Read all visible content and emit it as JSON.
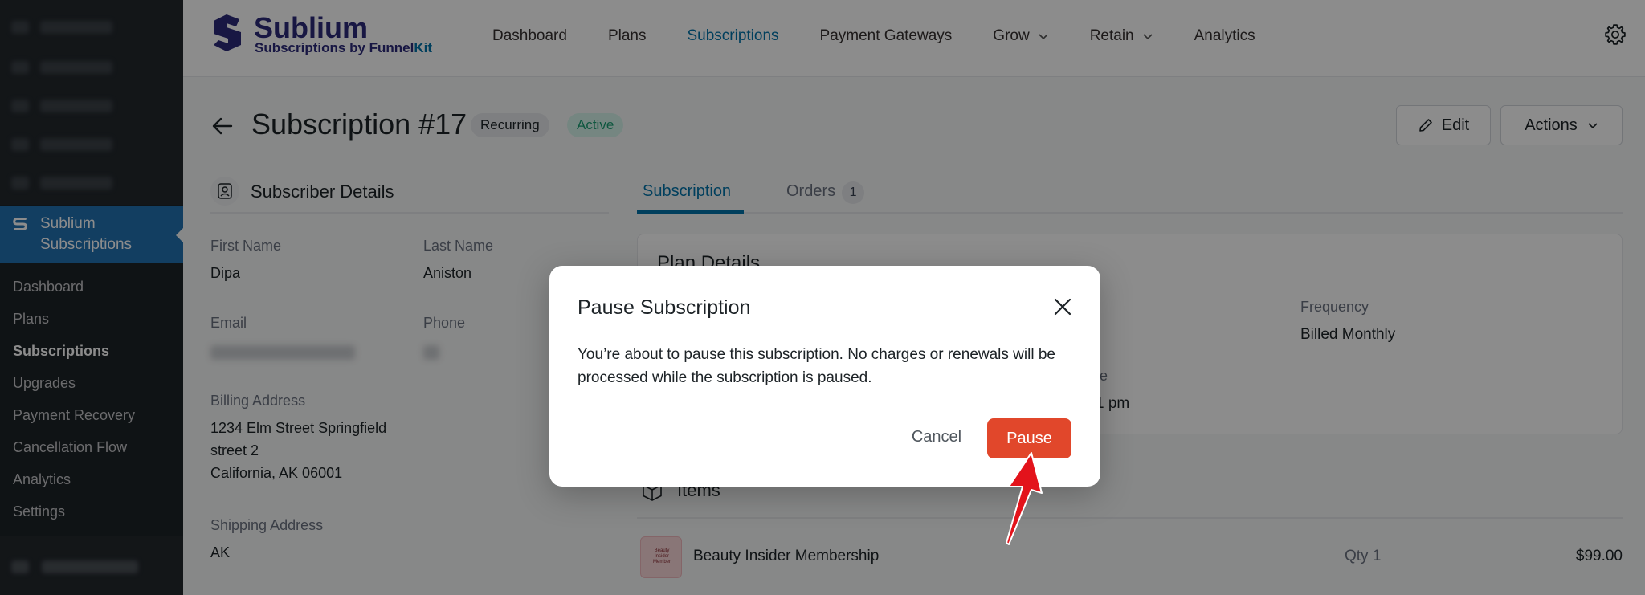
{
  "wp_sidebar": {
    "current_plugin": "Sublium Subscriptions",
    "submenu": [
      "Dashboard",
      "Plans",
      "Subscriptions",
      "Upgrades",
      "Payment Recovery",
      "Cancellation Flow",
      "Analytics",
      "Settings"
    ],
    "active_submenu": "Subscriptions"
  },
  "header": {
    "brand_name": "Sublium",
    "brand_sub_prefix": "Subscriptions by Funnel",
    "brand_sub_suffix": "Kit",
    "nav": [
      "Dashboard",
      "Plans",
      "Subscriptions",
      "Payment Gateways",
      "Grow",
      "Retain",
      "Analytics"
    ],
    "active_nav": "Subscriptions",
    "settings_icon": "gear-icon"
  },
  "page": {
    "title": "Subscription #17",
    "badge_type": "Recurring",
    "badge_status": "Active",
    "edit_label": "Edit",
    "actions_label": "Actions"
  },
  "subscriber": {
    "section_title": "Subscriber Details",
    "first_name_label": "First Name",
    "first_name": "Dipa",
    "last_name_label": "Last Name",
    "last_name": "Aniston",
    "email_label": "Email",
    "phone_label": "Phone",
    "billing_label": "Billing Address",
    "billing_line1": "1234 Elm Street Springfield",
    "billing_line2": "street 2",
    "billing_line3": "California, AK 06001",
    "shipping_label": "Shipping Address",
    "shipping_value": "AK"
  },
  "tabs": {
    "subscription": "Subscription",
    "orders": "Orders",
    "orders_count": "1"
  },
  "plan": {
    "title": "Plan Details",
    "frequency_label": "Frequency",
    "frequency_value": "Billed Monthly",
    "date_label_partial": "te",
    "date_value_partial": "1 pm"
  },
  "items": {
    "title": "Items",
    "rows": [
      {
        "name": "Beauty Insider Membership",
        "qty": "Qty 1",
        "price": "$99.00"
      }
    ]
  },
  "modal": {
    "title": "Pause Subscription",
    "body": "You’re about to pause this subscription. No charges or renewals will be processed while the subscription is paused.",
    "cancel_label": "Cancel",
    "pause_label": "Pause"
  },
  "colors": {
    "primary": "#0073aa",
    "brand": "#2d2a7b",
    "pause_button": "#e1472b",
    "active_badge_bg": "#d6f5ec",
    "active_badge_text": "#1a9e73",
    "annotation_arrow": "#e3131b"
  }
}
